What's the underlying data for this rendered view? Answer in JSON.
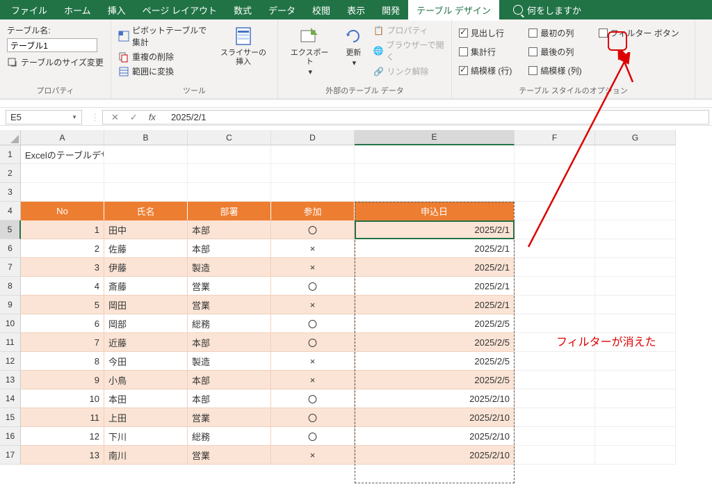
{
  "menu": {
    "items": [
      "ファイル",
      "ホーム",
      "挿入",
      "ページ レイアウト",
      "数式",
      "データ",
      "校閲",
      "表示",
      "開発",
      "テーブル デザイン"
    ],
    "active_index": 9,
    "tell_me": "何をしますか"
  },
  "ribbon": {
    "properties": {
      "table_name_label": "テーブル名:",
      "table_name_value": "テーブル1",
      "resize": "テーブルのサイズ変更",
      "group": "プロパティ"
    },
    "tools": {
      "pivot": "ピボットテーブルで集計",
      "remove_dup": "重複の削除",
      "convert_range": "範囲に変換",
      "slicer": "スライサーの\n挿入",
      "group": "ツール"
    },
    "external": {
      "export": "エクスポート",
      "refresh": "更新",
      "props": "プロパティ",
      "browser": "ブラウザーで開く",
      "unlink": "リンク解除",
      "group": "外部のテーブル データ"
    },
    "style_options": {
      "header_row": "見出し行",
      "total_row": "集計行",
      "banded_rows": "縞模様 (行)",
      "first_col": "最初の列",
      "last_col": "最後の列",
      "banded_cols": "縞模様 (列)",
      "filter_btn": "フィルター ボタン",
      "group": "テーブル スタイルのオプション"
    }
  },
  "formula_bar": {
    "name_box": "E5",
    "value": "2025/2/1"
  },
  "columns": [
    "A",
    "B",
    "C",
    "D",
    "E",
    "F",
    "G"
  ],
  "rows": [
    "1",
    "2",
    "3",
    "4",
    "5",
    "6",
    "7",
    "8",
    "9",
    "10",
    "11",
    "12",
    "13",
    "14",
    "15",
    "16",
    "17"
  ],
  "cell_a1": "Excelのテーブルデザイン",
  "table": {
    "headers": [
      "No",
      "氏名",
      "部署",
      "参加",
      "申込日"
    ],
    "data": [
      {
        "no": "1",
        "name": "田中",
        "dept": "本部",
        "join": "〇",
        "date": "2025/2/1"
      },
      {
        "no": "2",
        "name": "佐藤",
        "dept": "本部",
        "join": "×",
        "date": "2025/2/1"
      },
      {
        "no": "3",
        "name": "伊藤",
        "dept": "製造",
        "join": "×",
        "date": "2025/2/1"
      },
      {
        "no": "4",
        "name": "斎藤",
        "dept": "営業",
        "join": "〇",
        "date": "2025/2/1"
      },
      {
        "no": "5",
        "name": "岡田",
        "dept": "営業",
        "join": "×",
        "date": "2025/2/1"
      },
      {
        "no": "6",
        "name": "岡部",
        "dept": "総務",
        "join": "〇",
        "date": "2025/2/5"
      },
      {
        "no": "7",
        "name": "近藤",
        "dept": "本部",
        "join": "〇",
        "date": "2025/2/5"
      },
      {
        "no": "8",
        "name": "今田",
        "dept": "製造",
        "join": "×",
        "date": "2025/2/5"
      },
      {
        "no": "9",
        "name": "小鳥",
        "dept": "本部",
        "join": "×",
        "date": "2025/2/5"
      },
      {
        "no": "10",
        "name": "本田",
        "dept": "本部",
        "join": "〇",
        "date": "2025/2/10"
      },
      {
        "no": "11",
        "name": "上田",
        "dept": "営業",
        "join": "〇",
        "date": "2025/2/10"
      },
      {
        "no": "12",
        "name": "下川",
        "dept": "総務",
        "join": "〇",
        "date": "2025/2/10"
      },
      {
        "no": "13",
        "name": "南川",
        "dept": "営業",
        "join": "×",
        "date": "2025/2/10"
      }
    ]
  },
  "annotation": "フィルターが消えた"
}
